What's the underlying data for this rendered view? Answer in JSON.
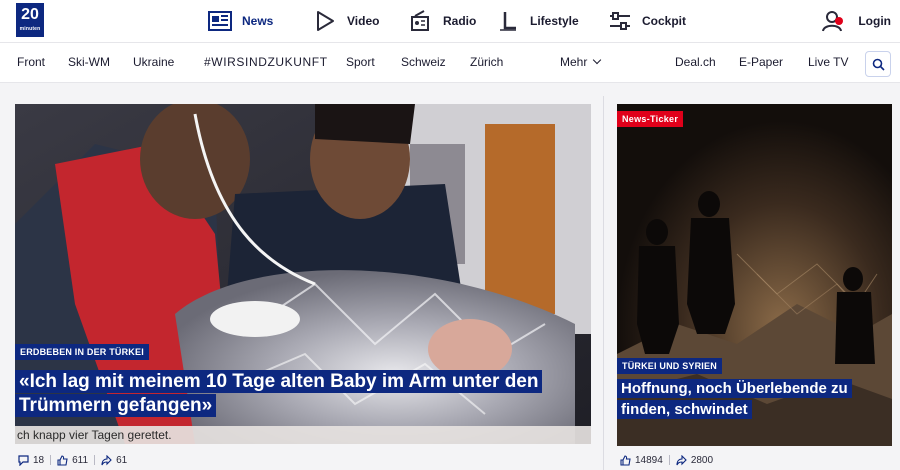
{
  "logo": {
    "number": "20",
    "word": "minuten"
  },
  "top_nav": [
    {
      "label": "News",
      "icon": "newspaper-icon",
      "active": true
    },
    {
      "label": "Video",
      "icon": "play-icon"
    },
    {
      "label": "Radio",
      "icon": "radio-icon"
    },
    {
      "label": "Lifestyle",
      "icon": "lifestyle-icon"
    },
    {
      "label": "Cockpit",
      "icon": "sliders-icon"
    }
  ],
  "login": {
    "label": "Login",
    "icon": "user-icon",
    "notification_color": "#e0001a"
  },
  "sub_nav": {
    "items": [
      "Front",
      "Ski-WM",
      "Ukraine",
      "#WIRSINDZUKUNFT",
      "Sport",
      "Schweiz",
      "Zürich"
    ],
    "more": "Mehr",
    "right_items": [
      "Deal.ch",
      "E-Paper",
      "Live TV"
    ],
    "search_icon": "search-icon"
  },
  "main_teaser": {
    "kicker": "Erdbeben in der Türkei",
    "headline": "«Ich lag mit meinem 10 Tage alten Baby im Arm unter den Trümmern gefangen»",
    "lead": "ch knapp vier Tagen gerettet.",
    "stats": {
      "comments": "18",
      "reactions": "611",
      "shares": "61"
    }
  },
  "side_teaser": {
    "badge": "News-Ticker",
    "kicker": "Türkei und Syrien",
    "headline": "Hoffnung, noch Überlebende zu finden, schwindet",
    "stats": {
      "reactions": "14894",
      "shares": "2800"
    }
  },
  "colors": {
    "brand": "#0d2880",
    "alert": "#e0001a",
    "background": "#f4f4f6"
  }
}
